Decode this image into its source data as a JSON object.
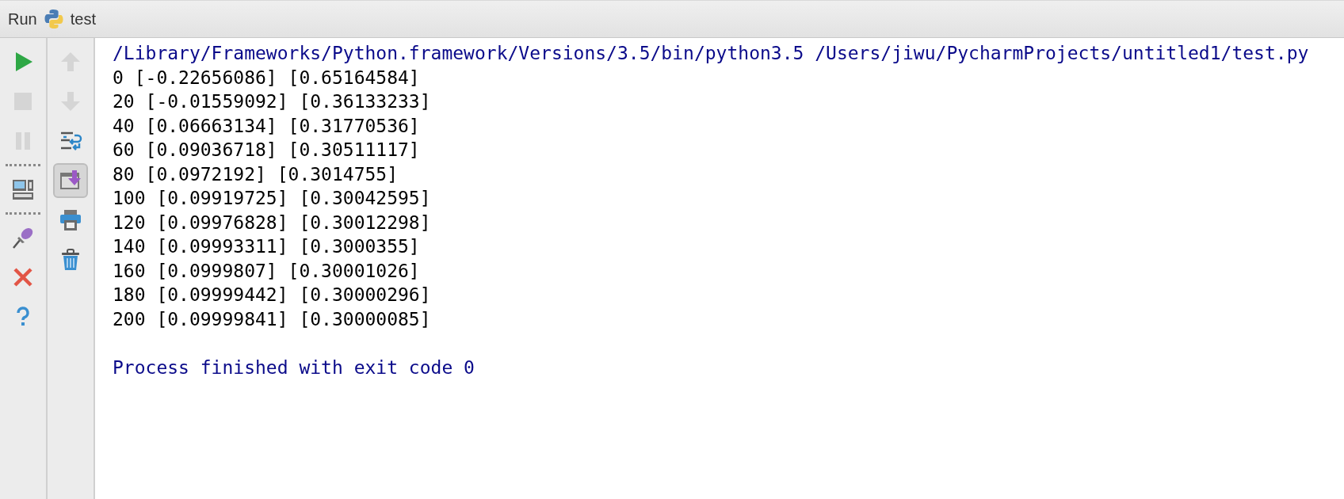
{
  "header": {
    "title": "Run",
    "config": "test"
  },
  "left_tools": [
    {
      "kind": "run",
      "disabled": false
    },
    {
      "kind": "stop",
      "disabled": true
    },
    {
      "kind": "pause",
      "disabled": true
    },
    {
      "kind": "separator"
    },
    {
      "kind": "layout",
      "disabled": false
    },
    {
      "kind": "separator"
    },
    {
      "kind": "pin",
      "disabled": false
    },
    {
      "kind": "close",
      "disabled": false
    },
    {
      "kind": "help",
      "disabled": false
    }
  ],
  "right_tools": [
    {
      "kind": "up",
      "disabled": true,
      "pressed": false
    },
    {
      "kind": "down",
      "disabled": true,
      "pressed": false
    },
    {
      "kind": "wrap",
      "disabled": false,
      "pressed": false
    },
    {
      "kind": "scroll-end",
      "disabled": false,
      "pressed": true
    },
    {
      "kind": "print",
      "disabled": false,
      "pressed": false
    },
    {
      "kind": "trash",
      "disabled": false,
      "pressed": false
    }
  ],
  "console": [
    {
      "kind": "system",
      "text": "/Library/Frameworks/Python.framework/Versions/3.5/bin/python3.5 /Users/jiwu/PycharmProjects/untitled1/test.py"
    },
    {
      "kind": "output",
      "text": "0 [-0.22656086] [0.65164584]"
    },
    {
      "kind": "output",
      "text": "20 [-0.01559092] [0.36133233]"
    },
    {
      "kind": "output",
      "text": "40 [0.06663134] [0.31770536]"
    },
    {
      "kind": "output",
      "text": "60 [0.09036718] [0.30511117]"
    },
    {
      "kind": "output",
      "text": "80 [0.0972192] [0.3014755]"
    },
    {
      "kind": "output",
      "text": "100 [0.09919725] [0.30042595]"
    },
    {
      "kind": "output",
      "text": "120 [0.09976828] [0.30012298]"
    },
    {
      "kind": "output",
      "text": "140 [0.09993311] [0.3000355]"
    },
    {
      "kind": "output",
      "text": "160 [0.0999807] [0.30001026]"
    },
    {
      "kind": "output",
      "text": "180 [0.09999442] [0.30000296]"
    },
    {
      "kind": "output",
      "text": "200 [0.09999841] [0.30000085]"
    },
    {
      "kind": "blank"
    },
    {
      "kind": "system",
      "text": "Process finished with exit code 0"
    }
  ]
}
